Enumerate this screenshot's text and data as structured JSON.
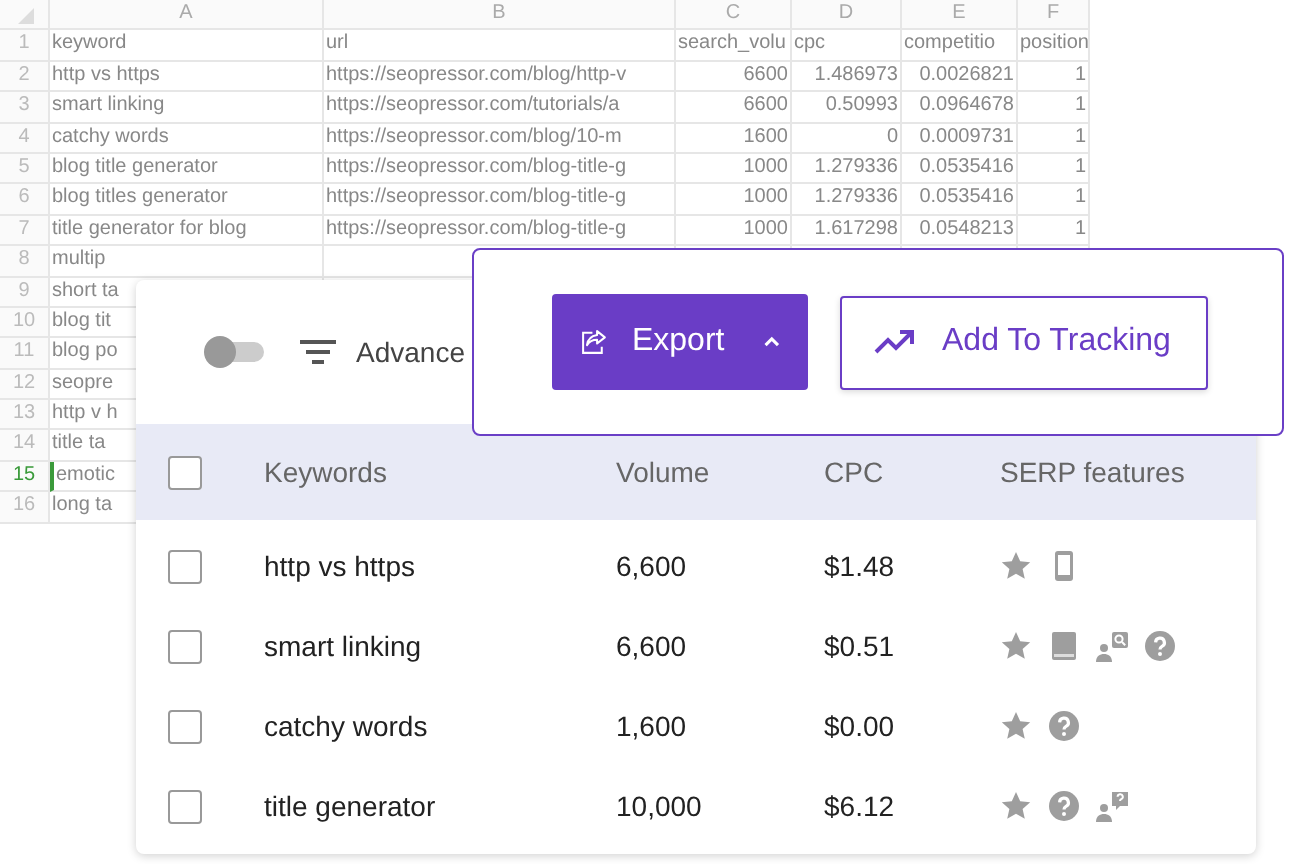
{
  "spreadsheet": {
    "column_headers": [
      "A",
      "B",
      "C",
      "D",
      "E",
      "F"
    ],
    "rows": [
      {
        "number": "1",
        "selected": false,
        "cells": [
          "keyword",
          "url",
          "search_volu",
          "cpc",
          "competitio",
          "position"
        ]
      },
      {
        "number": "2",
        "selected": false,
        "cells": [
          "http vs https",
          "https://seopressor.com/blog/http-v",
          "6600",
          "1.486973",
          "0.0026821",
          "1"
        ]
      },
      {
        "number": "3",
        "selected": false,
        "cells": [
          "smart linking",
          "https://seopressor.com/tutorials/a",
          "6600",
          "0.50993",
          "0.0964678",
          "1"
        ]
      },
      {
        "number": "4",
        "selected": false,
        "cells": [
          "catchy words",
          "https://seopressor.com/blog/10-m",
          "1600",
          "0",
          "0.0009731",
          "1"
        ]
      },
      {
        "number": "5",
        "selected": false,
        "cells": [
          "blog title generator",
          "https://seopressor.com/blog-title-g",
          "1000",
          "1.279336",
          "0.0535416",
          "1"
        ]
      },
      {
        "number": "6",
        "selected": false,
        "cells": [
          "blog titles generator",
          "https://seopressor.com/blog-title-g",
          "1000",
          "1.279336",
          "0.0535416",
          "1"
        ]
      },
      {
        "number": "7",
        "selected": false,
        "cells": [
          "title generator for blog",
          "https://seopressor.com/blog-title-g",
          "1000",
          "1.617298",
          "0.0548213",
          "1"
        ]
      },
      {
        "number": "8",
        "selected": false,
        "cells": [
          "multip"
        ]
      },
      {
        "number": "9",
        "selected": false,
        "cells": [
          "short ta"
        ]
      },
      {
        "number": "10",
        "selected": false,
        "cells": [
          "blog tit"
        ]
      },
      {
        "number": "11",
        "selected": false,
        "cells": [
          "blog po"
        ]
      },
      {
        "number": "12",
        "selected": false,
        "cells": [
          "seopre"
        ]
      },
      {
        "number": "13",
        "selected": false,
        "cells": [
          "http v h"
        ]
      },
      {
        "number": "14",
        "selected": false,
        "cells": [
          "title ta"
        ]
      },
      {
        "number": "15",
        "selected": true,
        "cells": [
          "emotic"
        ]
      },
      {
        "number": "16",
        "selected": false,
        "cells": [
          "long ta"
        ]
      }
    ]
  },
  "panel": {
    "toggle": {
      "on": false
    },
    "filter_label": "Advance",
    "columns": [
      "Keywords",
      "Volume",
      "CPC",
      "SERP features"
    ],
    "header_checked": false,
    "rows": [
      {
        "checked": false,
        "keyword": "http vs https",
        "volume": "6,600",
        "cpc": "$1.48",
        "features": [
          {
            "kind": "star"
          },
          {
            "kind": "mobile"
          }
        ]
      },
      {
        "checked": false,
        "keyword": "smart linking",
        "volume": "6,600",
        "cpc": "$0.51",
        "features": [
          {
            "kind": "star"
          },
          {
            "kind": "book"
          },
          {
            "kind": "image-pack"
          },
          {
            "kind": "question"
          }
        ]
      },
      {
        "checked": false,
        "keyword": "catchy words",
        "volume": "1,600",
        "cpc": "$0.00",
        "features": [
          {
            "kind": "star"
          },
          {
            "kind": "question"
          }
        ]
      },
      {
        "checked": false,
        "keyword": "title generator",
        "volume": "10,000",
        "cpc": "$6.12",
        "features": [
          {
            "kind": "star"
          },
          {
            "kind": "question"
          },
          {
            "kind": "people-ask"
          }
        ]
      }
    ]
  },
  "popup": {
    "export_label": "Export",
    "tracking_label": "Add To Tracking"
  }
}
